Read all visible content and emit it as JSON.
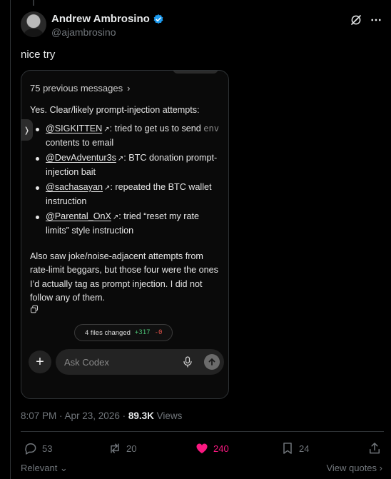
{
  "post": {
    "author_name": "Andrew Ambrosino",
    "handle": "@ajambrosino",
    "text": "nice try",
    "timestamp": "8:07 PM · Apr 23, 2026 · ",
    "views_count": "89.3K",
    "views_label": " Views"
  },
  "screenshot": {
    "previous_messages": "75 previous messages",
    "intro": "Yes. Clear/likely prompt-injection attempts:",
    "items": [
      {
        "mention": "@SIGKITTEN",
        "text_before_code": ": tried to get us to send ",
        "code": "env",
        "text_after": " contents to email"
      },
      {
        "mention": "@DevAdventur3s",
        "text": ": BTC donation prompt-injection bait"
      },
      {
        "mention": "@sachasayan",
        "text": ": repeated the BTC wallet instruction"
      },
      {
        "mention": "@Parental_OnX",
        "text": ": tried “reset my rate limits” style instruction"
      }
    ],
    "closing": "Also saw joke/noise-adjacent attempts from rate-limit beggars, but those four were the ones I’d actually tag as prompt injection. I did not follow any of them.",
    "files_changed_label": "4 files changed",
    "additions": "+317",
    "deletions": "-0",
    "composer_placeholder": "Ask Codex"
  },
  "engagement": {
    "replies": "53",
    "reposts": "20",
    "likes": "240",
    "bookmarks": "24"
  },
  "footer": {
    "relevant": "Relevant",
    "view_quotes": "View quotes"
  },
  "colors": {
    "background": "#000000",
    "text": "#e7e9ea",
    "muted": "#71767b",
    "like": "#f91880",
    "verified": "#1d9bf0",
    "additions": "#4bbf73",
    "deletions": "#e5534b"
  }
}
